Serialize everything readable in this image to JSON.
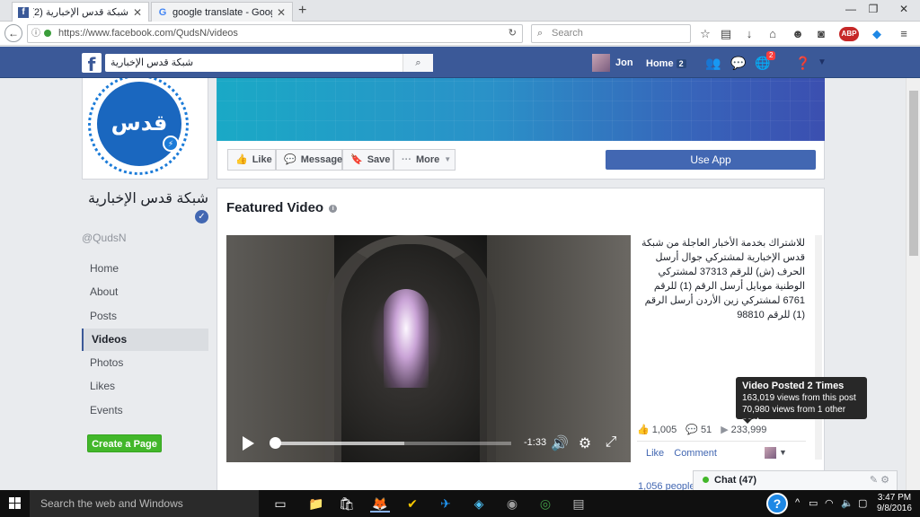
{
  "browser": {
    "tabs": [
      {
        "title": "شبكة قدس الإخبارية (2)",
        "active": true
      },
      {
        "title": "google translate - Google ...",
        "active": false
      }
    ],
    "url": "https://www.facebook.com/QudsN/videos",
    "search_placeholder": "Search",
    "new_tab": "+",
    "window_controls": {
      "minimize": "—",
      "restore": "❐",
      "close": "✕"
    }
  },
  "facebook": {
    "search_value": "شبكة قدس الإخبارية",
    "user_name": "Jon",
    "home_label": "Home",
    "home_count": "2",
    "notif_count": "2"
  },
  "page": {
    "logo_text": "قدس",
    "name": "شبكة قدس الإخبارية",
    "handle": "@QudsN",
    "nav": [
      {
        "label": "Home",
        "active": false
      },
      {
        "label": "About",
        "active": false
      },
      {
        "label": "Posts",
        "active": false
      },
      {
        "label": "Videos",
        "active": true
      },
      {
        "label": "Photos",
        "active": false
      },
      {
        "label": "Likes",
        "active": false
      },
      {
        "label": "Events",
        "active": false
      }
    ],
    "create_page": "Create a Page",
    "actions": {
      "like": "Like",
      "message": "Message",
      "save": "Save",
      "more": "More",
      "use_app": "Use App"
    }
  },
  "featured": {
    "title": "Featured Video",
    "time_remaining": "-1:33",
    "progress": 0.55,
    "description": "للاشتراك بخدمة الأخبار العاجلة من شبكة قدس الإخبارية لمشتركي جوال أرسل الحرف (ش) للرقم 37313 لمشتركي الوطنية موبايل أرسل الرقم (1) للرقم 6761 لمشتركي زين الأردن أرسل الرقم (1) للرقم 98810",
    "tooltip": {
      "title": "Video Posted 2 Times",
      "line1": "163,019 views from this post",
      "line2": "70,980 views from 1 other post"
    },
    "stats": {
      "likes": "1,005",
      "comments": "51",
      "views": "233,999"
    },
    "links": {
      "like": "Like",
      "comment": "Comment"
    },
    "people": "1,056 people"
  },
  "chat": {
    "label": "Chat (47)"
  },
  "taskbar": {
    "search_placeholder": "Search the web and Windows",
    "time": "3:47 PM",
    "date": "9/8/2016"
  }
}
